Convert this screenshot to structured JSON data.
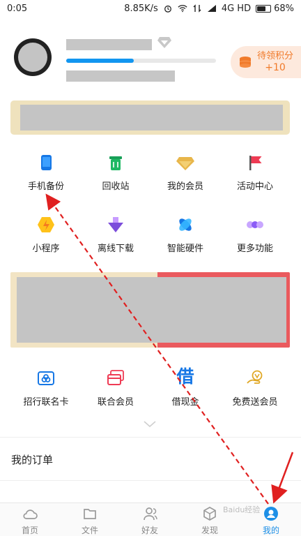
{
  "status_bar": {
    "time": "0:05",
    "net_speed": "8.85K/s",
    "network": "4G HD",
    "battery": "68%",
    "battery_level": 0.68
  },
  "profile": {
    "level_progress": 0.45,
    "points_label": "待领积分",
    "points_value": "+10"
  },
  "tools_row1": [
    {
      "label": "手机备份",
      "icon": "phone-backup-icon"
    },
    {
      "label": "回收站",
      "icon": "recycle-bin-icon"
    },
    {
      "label": "我的会员",
      "icon": "vip-diamond-icon"
    },
    {
      "label": "活动中心",
      "icon": "flag-icon"
    }
  ],
  "tools_row2": [
    {
      "label": "小程序",
      "icon": "mini-program-icon"
    },
    {
      "label": "离线下载",
      "icon": "offline-download-icon"
    },
    {
      "label": "智能硬件",
      "icon": "smart-hardware-icon"
    },
    {
      "label": "更多功能",
      "icon": "more-dots-icon"
    }
  ],
  "services": [
    {
      "label": "招行联名卡",
      "icon": "bank-card-icon"
    },
    {
      "label": "联合会员",
      "icon": "joint-member-card-icon"
    },
    {
      "label": "借现金",
      "icon": "borrow-cash-icon",
      "glyph": "借"
    },
    {
      "label": "免费送会员",
      "icon": "free-vip-icon"
    }
  ],
  "sections": {
    "my_orders": "我的订单"
  },
  "tabbar": [
    {
      "label": "首页",
      "icon": "cloud-icon",
      "active": false
    },
    {
      "label": "文件",
      "icon": "folder-icon",
      "active": false
    },
    {
      "label": "好友",
      "icon": "friends-icon",
      "active": false
    },
    {
      "label": "发现",
      "icon": "discover-icon",
      "active": false
    },
    {
      "label": "我的",
      "icon": "me-icon",
      "active": true
    }
  ],
  "watermark": "Baidu经验",
  "colors": {
    "accent_blue": "#1296f0",
    "points_orange": "#f07a2a",
    "annotation_red": "#e02020"
  }
}
